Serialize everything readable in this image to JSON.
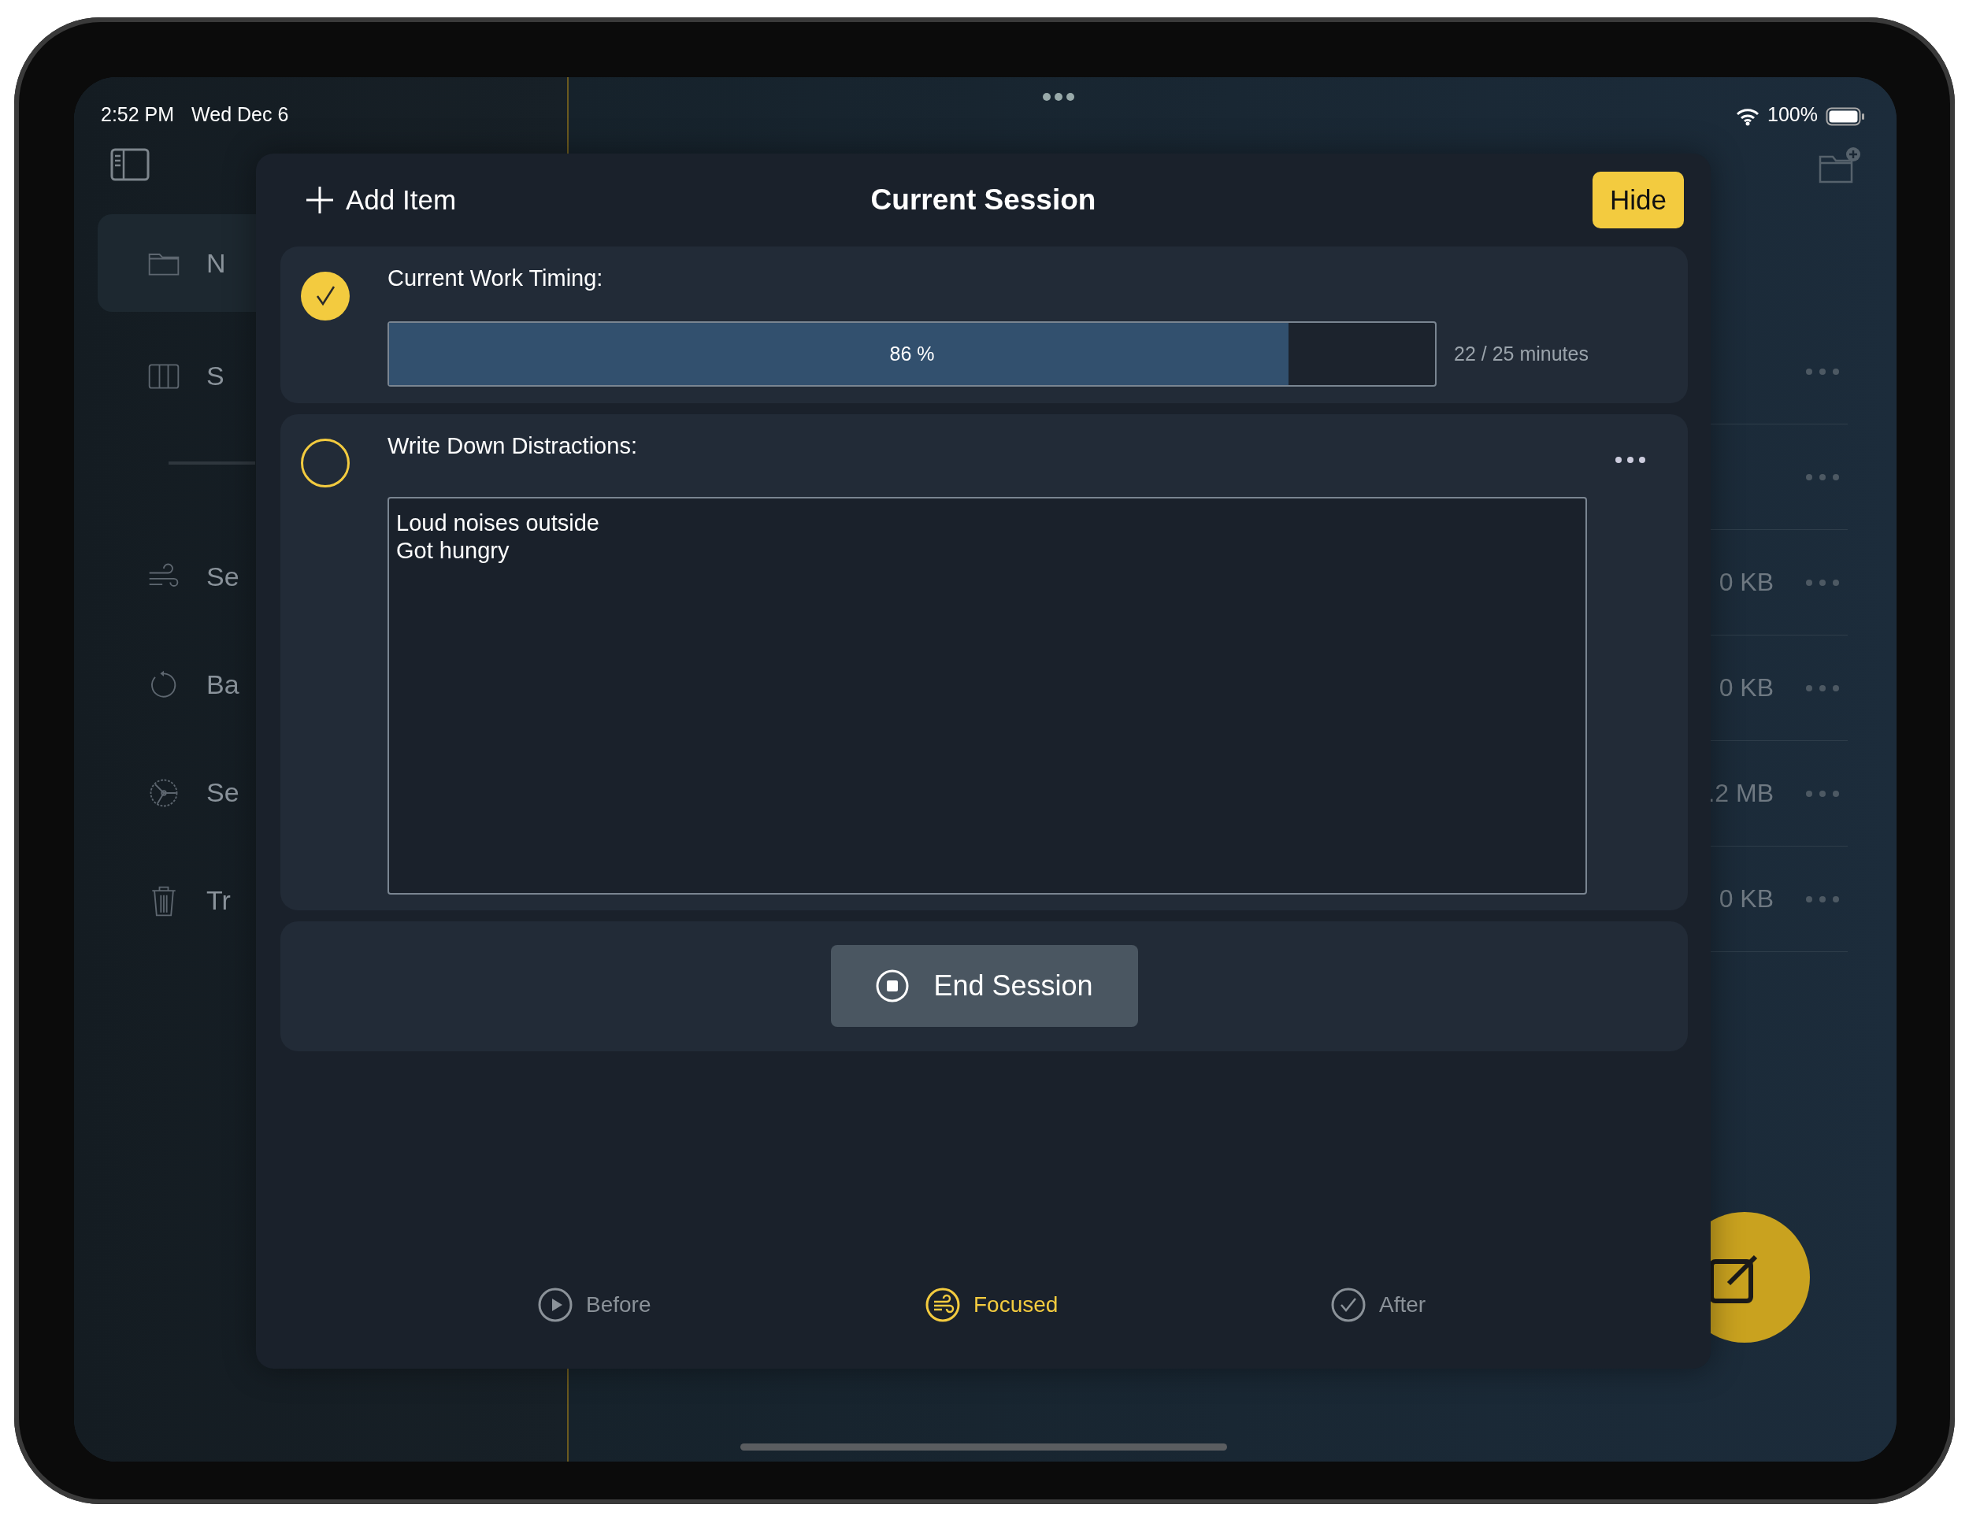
{
  "status_bar": {
    "time": "2:52 PM",
    "date": "Wed Dec 6",
    "battery": "100%"
  },
  "sidebar": {
    "items": [
      {
        "label": "N",
        "selected": true
      },
      {
        "label": "S",
        "selected": false
      },
      {
        "label": "Se",
        "selected": false
      },
      {
        "label": "Ba",
        "selected": false
      },
      {
        "label": "Se",
        "selected": false
      },
      {
        "label": "Tr",
        "selected": false
      }
    ]
  },
  "file_list": {
    "rows": [
      {
        "kind": "plain"
      },
      {
        "kind": "plain"
      },
      {
        "kind": "sized",
        "size": "0 KB"
      },
      {
        "kind": "sized",
        "size": "0 KB"
      },
      {
        "kind": "sized",
        "size": ".2 MB"
      },
      {
        "kind": "sized",
        "size": "0 KB"
      }
    ]
  },
  "modal": {
    "add_label": "Add Item",
    "title": "Current Session",
    "hide_label": "Hide",
    "items": [
      {
        "kind": "progress",
        "label": "Current Work Timing:",
        "checked": true,
        "level": 0.86,
        "reading": "86 %",
        "detail": "22 / 25 minutes"
      },
      {
        "kind": "notes",
        "label": "Write Down Distractions:",
        "checked": false,
        "value": "Loud noises outside\nGot hungry"
      }
    ],
    "end_button": "End Session",
    "tabs": [
      {
        "label": "Before",
        "selected": false
      },
      {
        "label": "Focused",
        "selected": true
      },
      {
        "label": "After",
        "selected": false
      }
    ]
  }
}
